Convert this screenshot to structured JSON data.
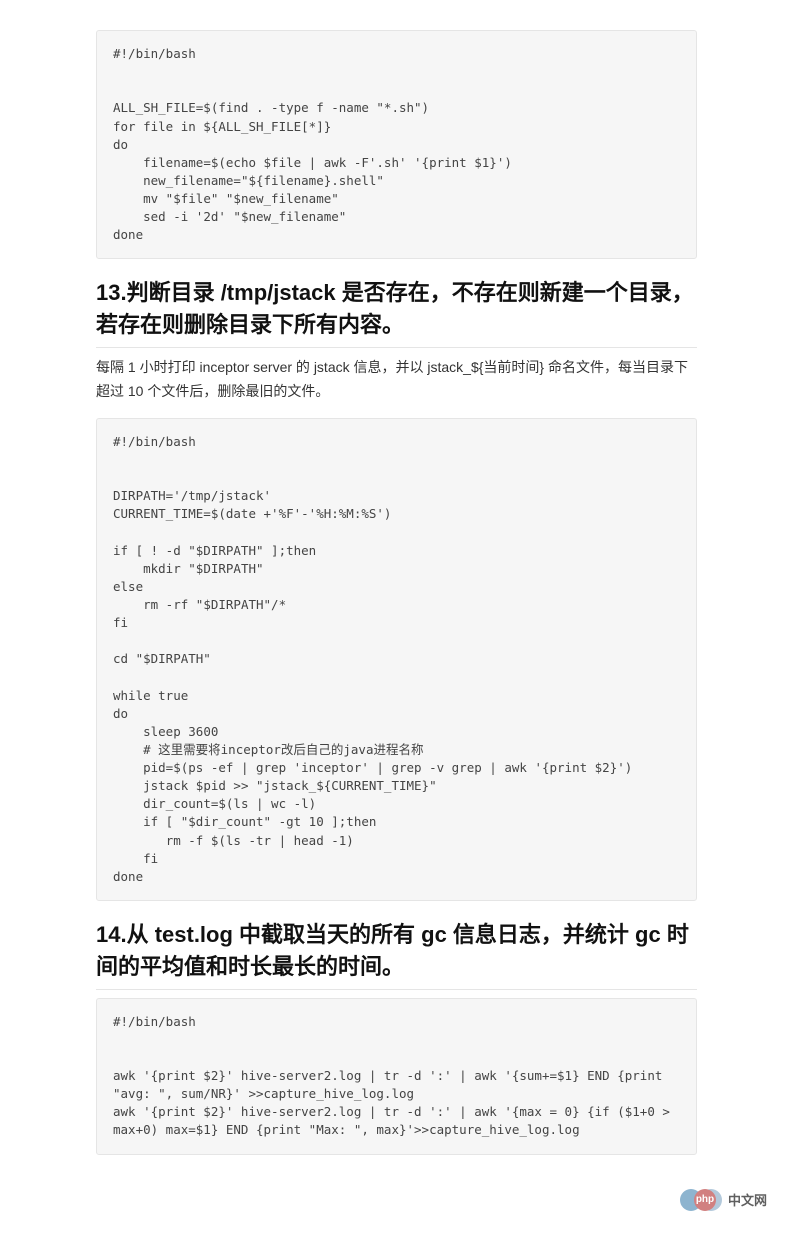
{
  "code_block_1": "#!/bin/bash\n\n\nALL_SH_FILE=$(find . -type f -name \"*.sh\")\nfor file in ${ALL_SH_FILE[*]}\ndo\n    filename=$(echo $file | awk -F'.sh' '{print $1}')\n    new_filename=\"${filename}.shell\"\n    mv \"$file\" \"$new_filename\"\n    sed -i '2d' \"$new_filename\"\ndone",
  "heading_13": "13.判断目录 /tmp/jstack 是否存在，不存在则新建一个目录，若存在则删除目录下所有内容。",
  "para_13": "每隔 1 小时打印 inceptor server 的 jstack 信息，并以 jstack_${当前时间} 命名文件，每当目录下超过 10 个文件后，删除最旧的文件。",
  "code_block_2": "#!/bin/bash\n\n\nDIRPATH='/tmp/jstack'\nCURRENT_TIME=$(date +'%F'-'%H:%M:%S')\n\nif [ ! -d \"$DIRPATH\" ];then\n    mkdir \"$DIRPATH\"\nelse\n    rm -rf \"$DIRPATH\"/*\nfi\n\ncd \"$DIRPATH\"\n\nwhile true\ndo\n    sleep 3600\n    # 这里需要将inceptor改后自己的java进程名称\n    pid=$(ps -ef | grep 'inceptor' | grep -v grep | awk '{print $2}')\n    jstack $pid >> \"jstack_${CURRENT_TIME}\"\n    dir_count=$(ls | wc -l)\n    if [ \"$dir_count\" -gt 10 ];then\n       rm -f $(ls -tr | head -1)\n    fi\ndone",
  "heading_14": "14.从 test.log 中截取当天的所有 gc 信息日志，并统计 gc 时间的平均值和时长最长的时间。",
  "code_block_3": "#!/bin/bash\n\n\nawk '{print $2}' hive-server2.log | tr -d ':' | awk '{sum+=$1} END {print \"avg: \", sum/NR}' >>capture_hive_log.log\nawk '{print $2}' hive-server2.log | tr -d ':' | awk '{max = 0} {if ($1+0 > max+0) max=$1} END {print \"Max: \", max}'>>capture_hive_log.log",
  "watermark": {
    "logo_text": "php",
    "site_text": "中文网"
  }
}
